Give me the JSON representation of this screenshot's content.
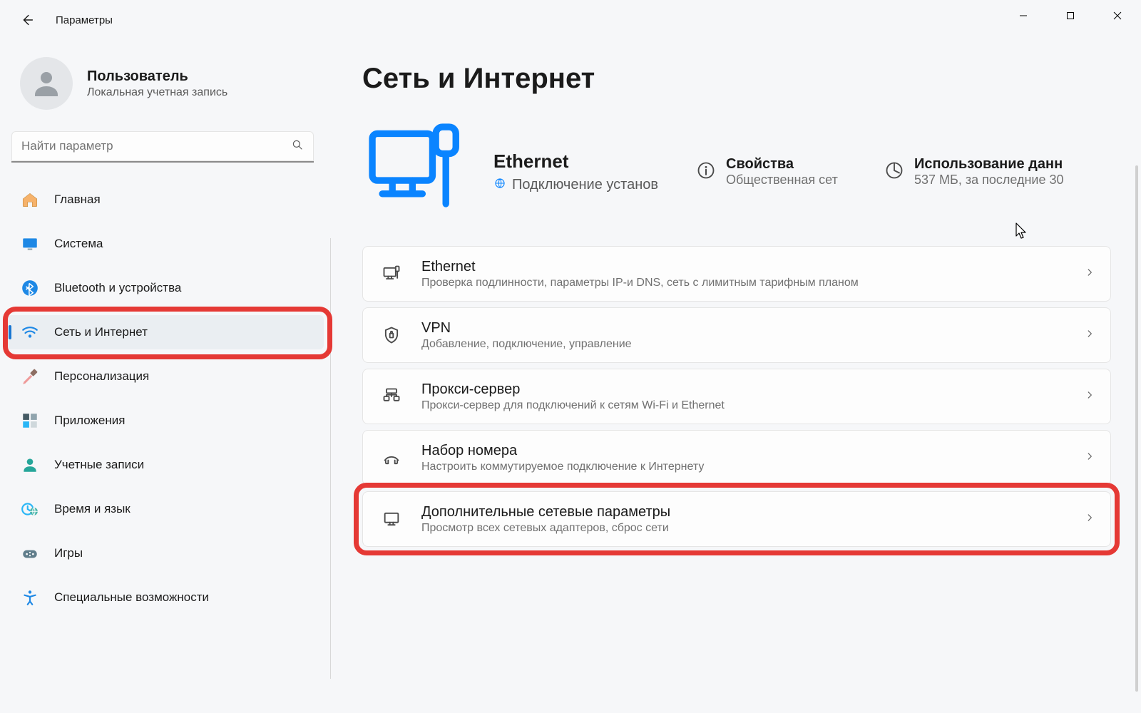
{
  "app_title": "Параметры",
  "account": {
    "name": "Пользователь",
    "subtitle": "Локальная учетная запись"
  },
  "search_placeholder": "Найти параметр",
  "sidebar": {
    "items": [
      {
        "label": "Главная",
        "icon": "home"
      },
      {
        "label": "Система",
        "icon": "system"
      },
      {
        "label": "Bluetooth и устройства",
        "icon": "bluetooth"
      },
      {
        "label": "Сеть и Интернет",
        "icon": "wifi",
        "selected": true
      },
      {
        "label": "Персонализация",
        "icon": "brush"
      },
      {
        "label": "Приложения",
        "icon": "apps"
      },
      {
        "label": "Учетные записи",
        "icon": "account"
      },
      {
        "label": "Время и язык",
        "icon": "timelang"
      },
      {
        "label": "Игры",
        "icon": "gaming"
      },
      {
        "label": "Специальные возможности",
        "icon": "access"
      }
    ]
  },
  "page": {
    "title": "Сеть и Интернет",
    "connection": {
      "name": "Ethernet",
      "status": "Подключение установ"
    },
    "props": {
      "label": "Свойства",
      "sub": "Общественная сет"
    },
    "usage": {
      "label": "Использование данн",
      "sub": "537 МБ, за последние 30"
    },
    "cards": [
      {
        "icon": "ethernet",
        "title": "Ethernet",
        "sub": "Проверка подлинности, параметры IP-и DNS, сеть с лимитным тарифным планом"
      },
      {
        "icon": "vpn",
        "title": "VPN",
        "sub": "Добавление, подключение, управление"
      },
      {
        "icon": "proxy",
        "title": "Прокси-сервер",
        "sub": "Прокси-сервер для подключений к сетям Wi-Fi и Ethernet"
      },
      {
        "icon": "dialup",
        "title": "Набор номера",
        "sub": "Настроить коммутируемое подключение к Интернету"
      },
      {
        "icon": "advanced",
        "title": "Дополнительные сетевые параметры",
        "sub": "Просмотр всех сетевых адаптеров, сброс сети"
      }
    ]
  },
  "highlights": {
    "sidebar_item_index": 3,
    "card_index": 4
  }
}
